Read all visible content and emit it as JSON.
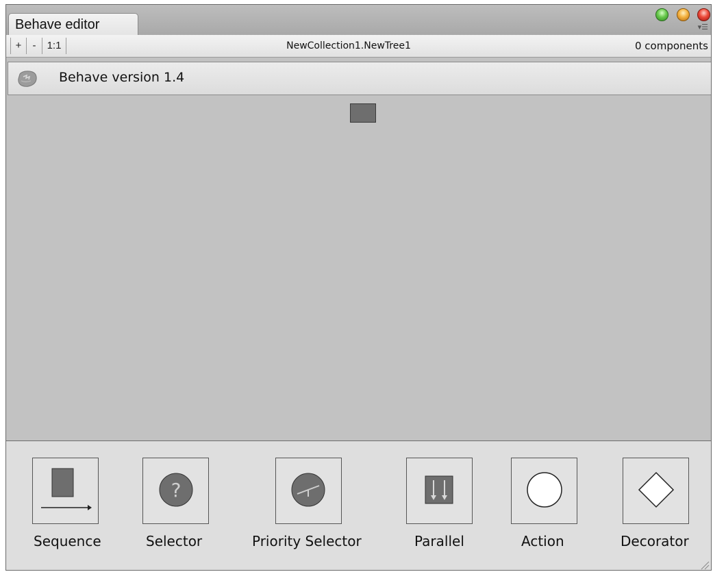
{
  "window": {
    "tab_title": "Behave editor",
    "menu_icon": "▾☰"
  },
  "toolbar": {
    "zoom_in": "+",
    "zoom_out": "-",
    "zoom_reset": "1:1",
    "tree_path": "NewCollection1.NewTree1",
    "component_count": "0 components"
  },
  "version_bar": {
    "logo_icon": "behave-logo-icon",
    "text": "Behave version 1.4"
  },
  "palette": {
    "items": [
      {
        "label": "Sequence",
        "icon": "sequence-icon"
      },
      {
        "label": "Selector",
        "icon": "selector-icon"
      },
      {
        "label": "Priority Selector",
        "icon": "priority-selector-icon"
      },
      {
        "label": "Parallel",
        "icon": "parallel-icon"
      },
      {
        "label": "Action",
        "icon": "action-icon"
      },
      {
        "label": "Decorator",
        "icon": "decorator-icon"
      }
    ]
  },
  "colors": {
    "canvas": "#c2c2c2",
    "palette": "#dedede",
    "node": "#6e6e6e"
  }
}
